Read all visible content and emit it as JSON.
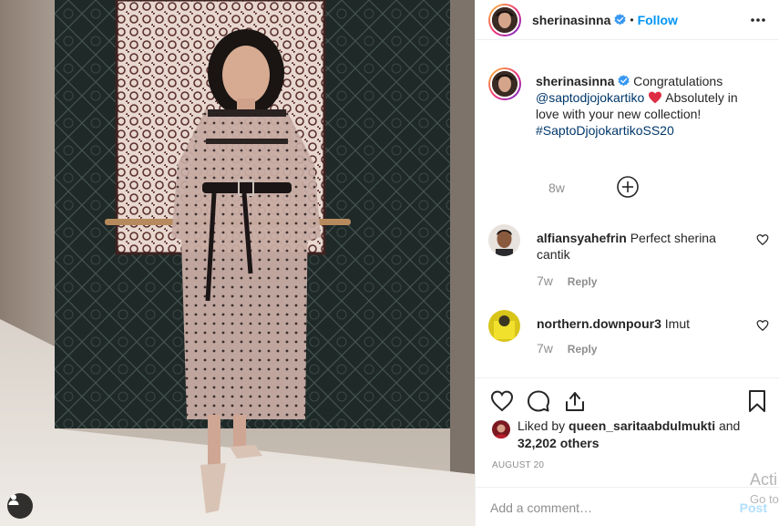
{
  "post": {
    "image_alt": "",
    "tag_icon": "user-tag-icon"
  },
  "header": {
    "username": "sherinasinna",
    "verified_icon": "verified-badge-icon",
    "separator": "•",
    "follow_label": "Follow",
    "more_icon": "more-options-icon"
  },
  "caption": {
    "username": "sherinasinna",
    "text_before": "Congratulations",
    "mention": "@saptodjojokartiko",
    "heart_icon": "red-heart-emoji",
    "text_after": "Absolutely in love with your new collection!",
    "hashtag": "#SaptoDjojokartikoSS20",
    "time": "8w"
  },
  "load_more_icon": "plus-circle-icon",
  "comments": [
    {
      "username": "alfiansyahefrin",
      "text": "Perfect sherina cantik",
      "time": "7w",
      "reply_label": "Reply"
    },
    {
      "username": "northern.downpour3",
      "text": "Imut",
      "time": "7w",
      "reply_label": "Reply"
    }
  ],
  "actions": {
    "like_icon": "heart-outline-icon",
    "comment_icon": "comment-icon",
    "share_icon": "share-icon",
    "save_icon": "bookmark-icon"
  },
  "likes": {
    "prefix": "Liked by",
    "user": "queen_saritaabdulmukti",
    "and": "and",
    "others": "32,202 others"
  },
  "date": "AUGUST 20",
  "add_comment": {
    "placeholder": "Add a comment…",
    "post_label": "Post"
  },
  "watermark": {
    "line1": "Acti",
    "line2": "Go to"
  },
  "colors": {
    "accent": "#0095f6",
    "link": "#00376b",
    "muted": "#8e8e8e",
    "heart_red": "#ed4956",
    "post_disabled": "#b2dffc"
  }
}
